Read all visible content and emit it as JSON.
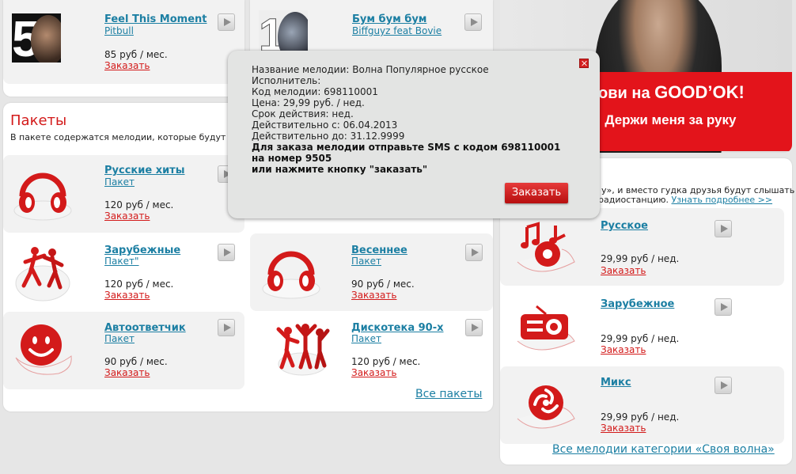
{
  "top_tracks": [
    {
      "title": "Feel This Moment",
      "artist": "Pitbull",
      "price": "85 руб / мес.",
      "order": "Заказать",
      "cover_number": "5"
    },
    {
      "title": "Бум бум бум",
      "artist": "Biffguyz feat Bovie",
      "cover_number": "10"
    }
  ],
  "packages": {
    "heading": "Пакеты",
    "description": "В пакете содержатся мелодии, которые будут пр",
    "items": [
      {
        "title": "Русские хиты",
        "sub": "Пакет",
        "price": "120 руб / мес.",
        "order": "Заказать",
        "icon": "headphones-icon"
      },
      {
        "title": "Зарубежные",
        "sub": "Пакет\"",
        "price": "120 руб / мес.",
        "order": "Заказать",
        "icon": "dancers-icon"
      },
      {
        "title": "Весеннее",
        "sub": "Пакет",
        "price": "90 руб / мес.",
        "order": "Заказать",
        "icon": "headphones-icon"
      },
      {
        "title": "Автоответчик",
        "sub": "Пакет",
        "price": "90 руб / мес.",
        "order": "Заказать",
        "icon": "smiley-icon"
      },
      {
        "title": "Дискотека 90-х",
        "sub": "Пакет",
        "price": "120 руб / мес.",
        "order": "Заказать",
        "icon": "disco-dancers-icon"
      }
    ],
    "all_link": "Все пакеты"
  },
  "banner": {
    "line1": "ови на",
    "brand": "GOOD’OK!",
    "line2": "· Держи меня за руку"
  },
  "wave": {
    "desc_line1": "у», и вместо гудка друзья будут слышать",
    "desc_line2": "радиостанцию.",
    "more_link": "Узнать подробнее >>",
    "items": [
      {
        "title": "Русское",
        "price": "29,99 руб / нед.",
        "order": "Заказать",
        "icon": "music-notes-icon"
      },
      {
        "title": "Зарубежное",
        "price": "29,99 руб / нед.",
        "order": "Заказать",
        "icon": "radio-icon"
      },
      {
        "title": "Микс",
        "price": "29,99 руб / нед.",
        "order": "Заказать",
        "icon": "mix-icon"
      }
    ],
    "all_link": "Все мелодии категории «Своя волна»"
  },
  "popup": {
    "lines": [
      "Название мелодии: Волна Популярное русское",
      "Исполнитель:",
      "Код мелодии: 698110001",
      "Цена: 29,99 руб. / нед.",
      "Срок действия: нед.",
      "Действительно с: 06.04.2013",
      "Действительно до: 31.12.9999"
    ],
    "bold_lines": [
      "Для заказа мелодии отправьте SMS с кодом 698110001",
      "на номер 9505",
      "или нажмите кнопку \"заказать\""
    ],
    "order_button": "Заказать"
  },
  "colors": {
    "accent_red": "#d31a1a",
    "link_blue": "#1c7fa3",
    "banner_red": "#e3141b"
  }
}
